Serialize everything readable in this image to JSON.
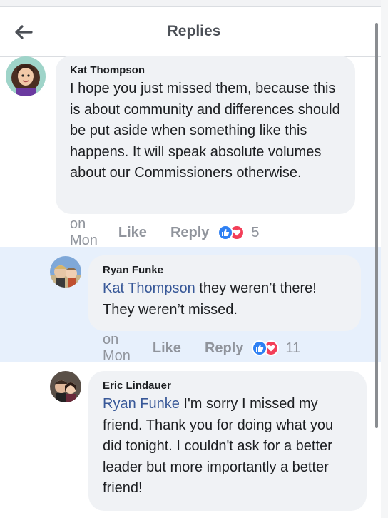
{
  "header": {
    "title": "Replies",
    "back_icon": "arrow-left-icon"
  },
  "comments": [
    {
      "author": "Kat Thompson",
      "text": "I hope you just missed them, because this is about community and differences should be put aside when something like this happens. It will speak absolute volumes about our Commissioners otherwise.",
      "time": "on Mon",
      "like_label": "Like",
      "reply_label": "Reply",
      "reaction_count": "5",
      "reactions": [
        "like-icon",
        "love-icon"
      ]
    },
    {
      "author": "Ryan Funke",
      "mention": "Kat Thompson",
      "text": " they weren’t there! They weren’t missed.",
      "time": "on Mon",
      "like_label": "Like",
      "reply_label": "Reply",
      "reaction_count": "11",
      "reactions": [
        "like-icon",
        "love-icon"
      ],
      "highlighted": true
    },
    {
      "author": "Eric Lindauer",
      "mention": "Ryan Funke",
      "text": " I'm sorry I missed my friend. Thank you for doing what you did tonight. I couldn't ask for a better leader but more importantly a better friend!"
    }
  ],
  "colors": {
    "accent": "#385898",
    "bubble": "#f0f2f5",
    "highlight": "#e7f0fc",
    "like": "#2f80f3",
    "love": "#f33e58"
  }
}
